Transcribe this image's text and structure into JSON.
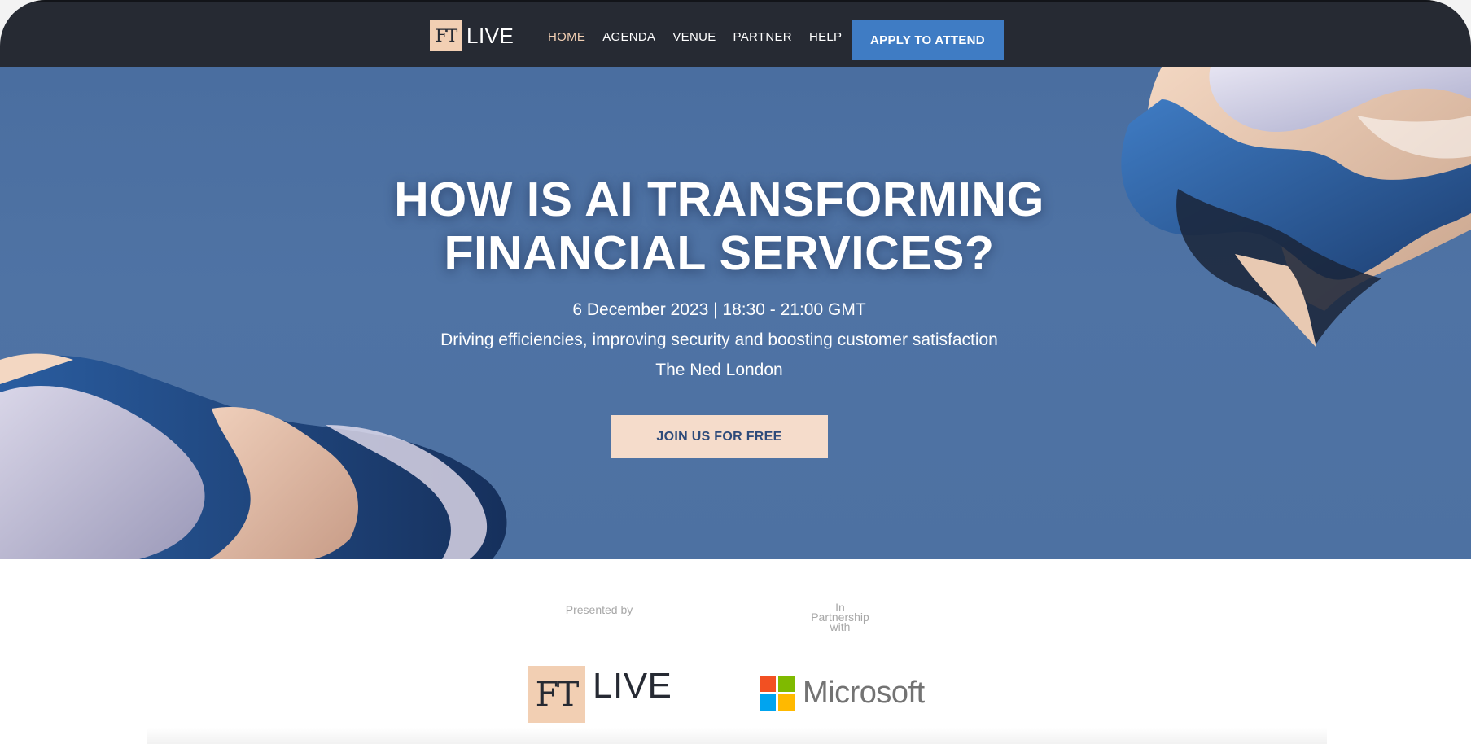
{
  "nav": {
    "logo": {
      "ft": "FT",
      "live": "LIVE"
    },
    "links": [
      {
        "label": "HOME",
        "active": true
      },
      {
        "label": "AGENDA",
        "active": false
      },
      {
        "label": "VENUE",
        "active": false
      },
      {
        "label": "PARTNER",
        "active": false
      },
      {
        "label": "HELP",
        "active": false
      }
    ],
    "apply_label": "APPLY TO ATTEND"
  },
  "hero": {
    "title_line1": "HOW IS AI TRANSFORMING",
    "title_line2": "FINANCIAL SERVICES?",
    "date": "6 December 2023 | 18:30 - 21:00 GMT",
    "tagline": "Driving efficiencies, improving security and boosting customer satisfaction",
    "venue": "The Ned London",
    "cta_label": "JOIN US FOR FREE"
  },
  "partners": {
    "presented_label": "Presented by",
    "partnership_label_lines": [
      "In",
      "Partnership",
      "with"
    ],
    "presenter": {
      "ft": "FT",
      "live": "LIVE"
    },
    "partner": {
      "name": "Microsoft"
    }
  },
  "colors": {
    "nav_bg": "#262a33",
    "accent_peach": "#f2cfb3",
    "apply_blue": "#3f7cc4",
    "hero_blue": "#4d71a2",
    "cta_bg": "#f5dccb",
    "cta_text": "#2e4b7a",
    "ms_red": "#f25022",
    "ms_green": "#7fba00",
    "ms_blue": "#00a4ef",
    "ms_yellow": "#ffb900"
  }
}
